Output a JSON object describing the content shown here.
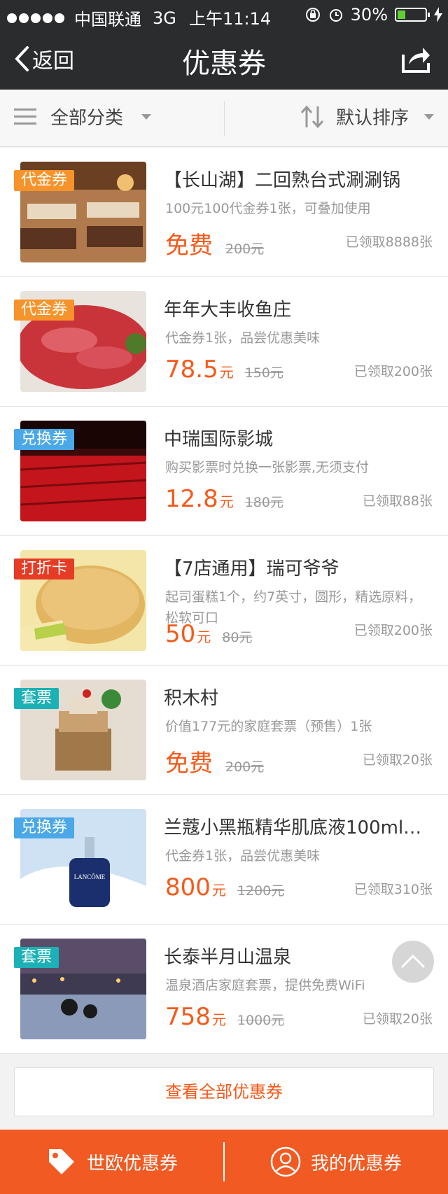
{
  "status_bar": {
    "carrier": "中国联通",
    "network": "3G",
    "time": "上午11:14",
    "battery": "30%"
  },
  "nav": {
    "back_label": "返回",
    "title": "优惠券"
  },
  "filters": {
    "category_label": "全部分类",
    "sort_label": "默认排序"
  },
  "items": [
    {
      "tag": "代金券",
      "tag_color": "#f7932b",
      "title": "【长山湖】二回熟台式涮涮锅",
      "desc": "100元100代金券1张，可叠加使用",
      "price": "免费",
      "unit": "",
      "orig": "200元",
      "claimed": "已领取8888张"
    },
    {
      "tag": "代金券",
      "tag_color": "#f7932b",
      "title": "年年大丰收鱼庄",
      "desc": "代金券1张，品尝优惠美味",
      "price": "78.5",
      "unit": "元",
      "orig": "150元",
      "claimed": "已领取200张"
    },
    {
      "tag": "兑换券",
      "tag_color": "#4aa8e8",
      "title": "中瑞国际影城",
      "desc": "购买影票时兑换一张影票,无须支付",
      "price": "12.8",
      "unit": "元",
      "orig": "180元",
      "claimed": "已领取88张"
    },
    {
      "tag": "打折卡",
      "tag_color": "#e63b24",
      "title": "【7店通用】瑞可爷爷",
      "desc": "起司蛋糕1个，约7英寸，圆形，精选原料，松软可口",
      "price": "50",
      "unit": "元",
      "orig": "80元",
      "claimed": "已领取200张"
    },
    {
      "tag": "套票",
      "tag_color": "#1bb1b6",
      "title": "积木村",
      "desc": "价值177元的家庭套票（预售）1张",
      "price": "免费",
      "unit": "",
      "orig": "200元",
      "claimed": "已领取20张"
    },
    {
      "tag": "兑换券",
      "tag_color": "#4aa8e8",
      "title": "兰蔻小黑瓶精华肌底液100ml…",
      "desc": "代金券1张，品尝优惠美味",
      "price": "800",
      "unit": "元",
      "orig": "1200元",
      "claimed": "已领取310张"
    },
    {
      "tag": "套票",
      "tag_color": "#1bb1b6",
      "title": "长泰半月山温泉",
      "desc": "温泉酒店家庭套票，提供免费WiFi",
      "price": "758",
      "unit": "元",
      "orig": "1000元",
      "claimed": "已领取20张"
    }
  ],
  "view_all_label": "查看全部优惠券",
  "tabs": {
    "shiou_label": "世欧优惠券",
    "mine_label": "我的优惠券"
  },
  "colors": {
    "accent": "#f15a22",
    "price": "#f6591a",
    "nav_bg": "#2a2c2e"
  },
  "icons": [
    "back-chevron-icon",
    "share-icon",
    "menu-icon",
    "sort-icon",
    "scroll-top-icon",
    "tag-icon",
    "user-icon"
  ]
}
